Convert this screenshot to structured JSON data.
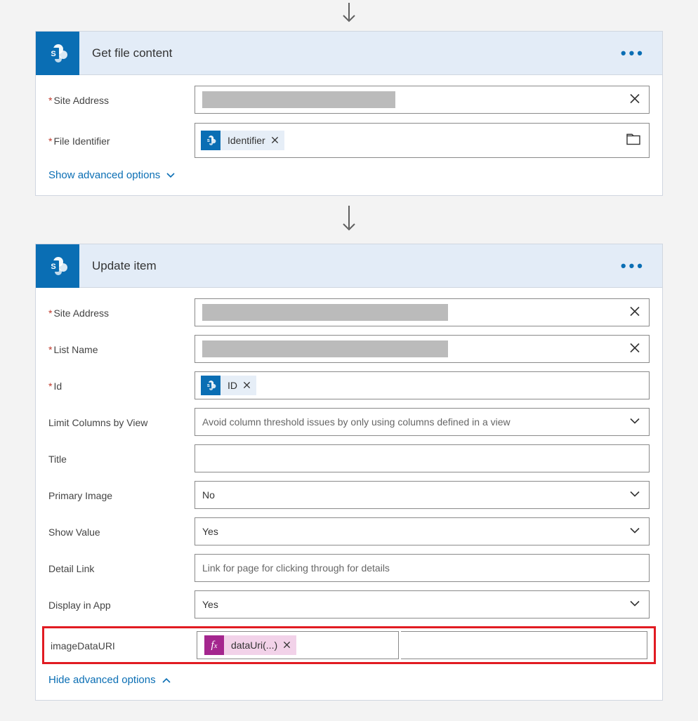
{
  "actions": {
    "get_file_content": {
      "title": "Get file content",
      "fields": {
        "site_address": {
          "label": "Site Address"
        },
        "file_identifier": {
          "label": "File Identifier",
          "token": "Identifier"
        }
      },
      "advanced_link": "Show advanced options"
    },
    "update_item": {
      "title": "Update item",
      "fields": {
        "site_address": {
          "label": "Site Address"
        },
        "list_name": {
          "label": "List Name"
        },
        "id": {
          "label": "Id",
          "token": "ID"
        },
        "limit_columns": {
          "label": "Limit Columns by View",
          "placeholder": "Avoid column threshold issues by only using columns defined in a view"
        },
        "title": {
          "label": "Title"
        },
        "primary_image": {
          "label": "Primary Image",
          "value": "No"
        },
        "show_value": {
          "label": "Show Value",
          "value": "Yes"
        },
        "detail_link": {
          "label": "Detail Link",
          "placeholder": "Link for page for clicking through for details"
        },
        "display_in_app": {
          "label": "Display in App",
          "value": "Yes"
        },
        "image_data_uri": {
          "label": "imageDataURI",
          "fx_token": "dataUri(...)"
        }
      },
      "advanced_link": "Hide advanced options"
    }
  },
  "icons": {
    "fx": "fx"
  }
}
